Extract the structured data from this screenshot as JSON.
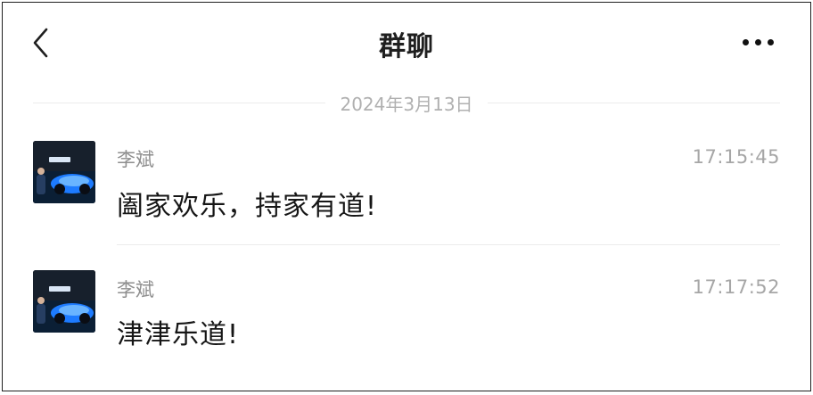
{
  "header": {
    "title": "群聊",
    "back_icon": "chevron-left-icon",
    "more_icon": "more-horizontal-icon"
  },
  "date_divider": {
    "text": "2024年3月13日"
  },
  "messages": [
    {
      "sender": "李斌",
      "time": "17:15:45",
      "text": "阖家欢乐，持家有道!",
      "avatar_icon": "user-avatar-car-photo"
    },
    {
      "sender": "李斌",
      "time": "17:17:52",
      "text": "津津乐道!",
      "avatar_icon": "user-avatar-car-photo"
    }
  ],
  "colors": {
    "text_primary": "#161616",
    "text_secondary": "#8e8e8e",
    "divider": "#ebebeb",
    "avatar_accent": "#1f6fff"
  }
}
